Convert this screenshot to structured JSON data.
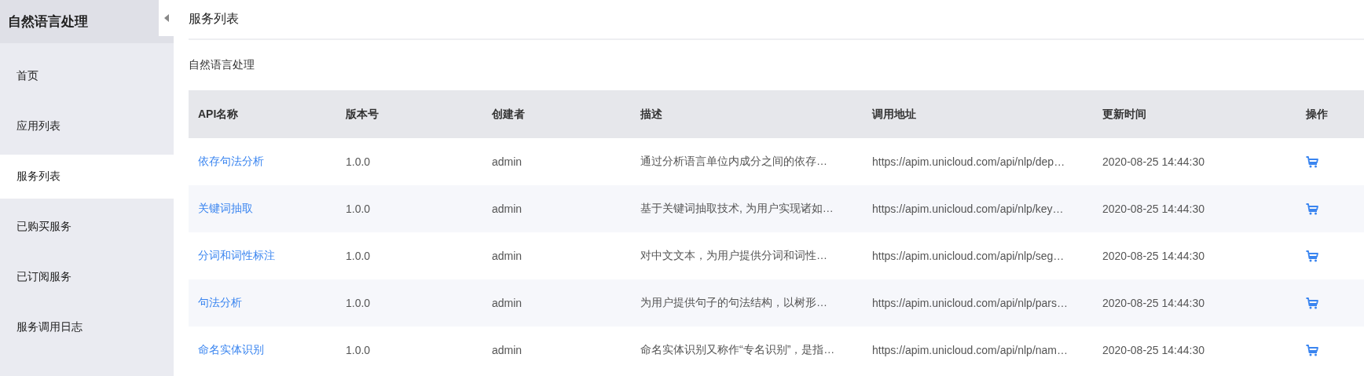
{
  "sidebar": {
    "title": "自然语言处理",
    "items": [
      {
        "label": "首页",
        "selected": false
      },
      {
        "label": "应用列表",
        "selected": false
      },
      {
        "label": "服务列表",
        "selected": true
      },
      {
        "label": "已购买服务",
        "selected": false
      },
      {
        "label": "已订阅服务",
        "selected": false
      },
      {
        "label": "服务调用日志",
        "selected": false
      }
    ]
  },
  "page": {
    "title": "服务列表",
    "section": "自然语言处理"
  },
  "table": {
    "columns": [
      "API名称",
      "版本号",
      "创建者",
      "描述",
      "调用地址",
      "更新时间",
      "操作"
    ],
    "rows": [
      {
        "name": "依存句法分析",
        "version": "1.0.0",
        "creator": "admin",
        "description": "通过分析语言单位内成分之间的依存…",
        "url": "https://apim.unicloud.com/api/nlp/dep…",
        "updated": "2020-08-25 14:44:30"
      },
      {
        "name": "关键词抽取",
        "version": "1.0.0",
        "creator": "admin",
        "description": "基于关键词抽取技术, 为用户实现诸如…",
        "url": "https://apim.unicloud.com/api/nlp/key…",
        "updated": "2020-08-25 14:44:30"
      },
      {
        "name": "分词和词性标注",
        "version": "1.0.0",
        "creator": "admin",
        "description": "对中文文本，为用户提供分词和词性…",
        "url": "https://apim.unicloud.com/api/nlp/seg…",
        "updated": "2020-08-25 14:44:30"
      },
      {
        "name": "句法分析",
        "version": "1.0.0",
        "creator": "admin",
        "description": "为用户提供句子的句法结构，以树形…",
        "url": "https://apim.unicloud.com/api/nlp/pars…",
        "updated": "2020-08-25 14:44:30"
      },
      {
        "name": "命名实体识别",
        "version": "1.0.0",
        "creator": "admin",
        "description": "命名实体识别又称作“专名识别”，是指…",
        "url": "https://apim.unicloud.com/api/nlp/nam…",
        "updated": "2020-08-25 14:44:30"
      }
    ]
  }
}
